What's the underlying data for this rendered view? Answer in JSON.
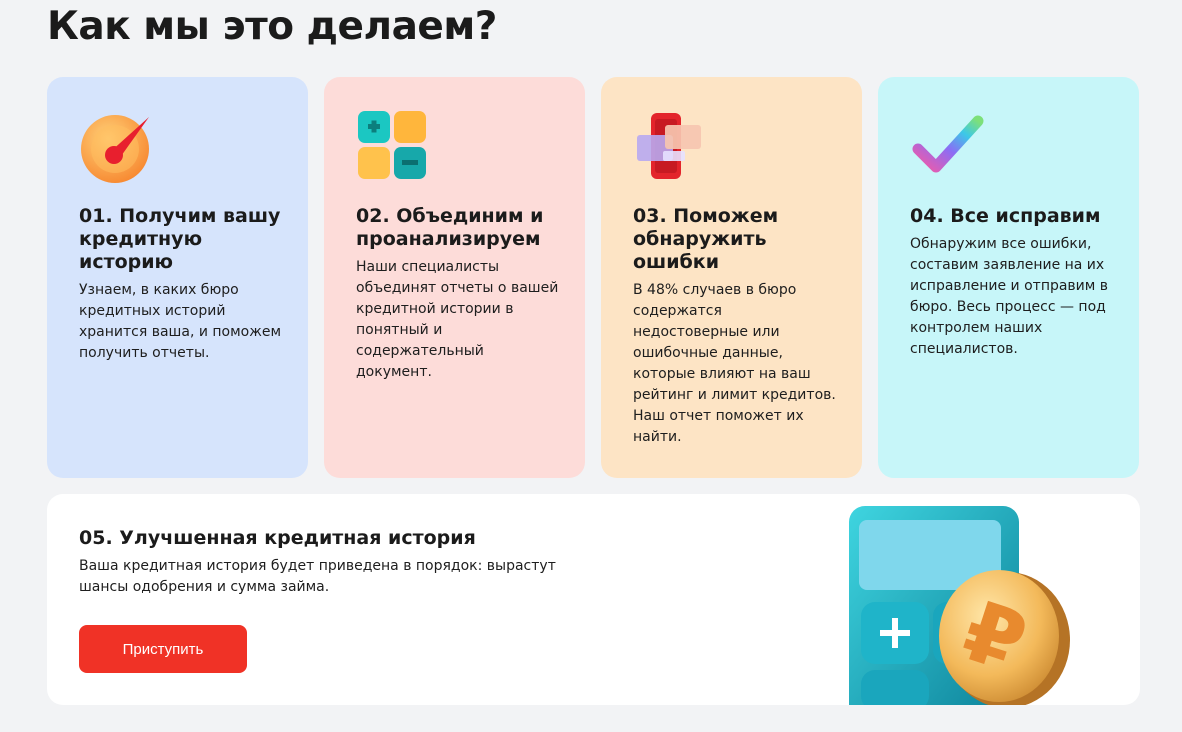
{
  "page": {
    "title": "Как мы это делаем?"
  },
  "steps": [
    {
      "icon": "speedometer-icon",
      "title": "01. Получим вашу кредитную историю",
      "text": "Узнаем, в каких бюро кредитных историй хранится ваша, и поможем получить отчеты."
    },
    {
      "icon": "calculator-keys-icon",
      "title": "02. Объединим и проанализируем",
      "text": "Наши специалисты объединят отчеты о вашей кредитной истории в понятный и содержательный документ."
    },
    {
      "icon": "phone-documents-icon",
      "title": "03. Поможем обнаружить ошибки",
      "text": "В 48% случаев в бюро содержатся недостоверные или ошибочные данные, которые влияют на ваш рейтинг и лимит кредитов. Наш отчет поможет их найти."
    },
    {
      "icon": "checkmark-icon",
      "title": "04. Все исправим",
      "text": "Обнаружим все ошибки, составим заявление на их исправление и отправим в бюро. Весь процесс — под контролем наших специалистов."
    }
  ],
  "result": {
    "title": "05. Улучшенная кредитная история",
    "text": "Ваша кредитная история будет приведена в порядок: вырастут шансы одобрения и сумма займа.",
    "button_label": "Приступить",
    "illustration": "calculator-ruble-coin-icon"
  },
  "colors": {
    "card_1": "#d6e4fc",
    "card_2": "#fddcd9",
    "card_3": "#fde4c5",
    "card_4": "#c7f6f9",
    "button": "#f03226"
  }
}
